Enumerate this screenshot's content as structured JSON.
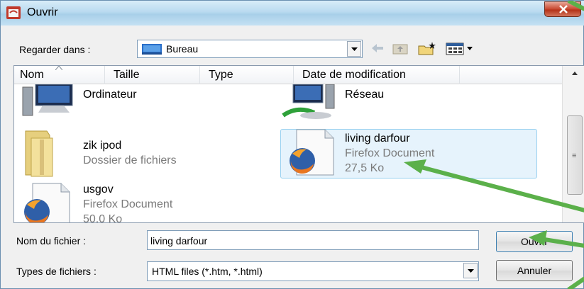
{
  "window": {
    "title": "Ouvrir",
    "close_label": "x"
  },
  "lookin": {
    "label": "Regarder dans :",
    "value": "Bureau",
    "icon": "desktop-icon"
  },
  "toolbar": {
    "icons": [
      "back-arrow-icon",
      "up-folder-icon",
      "new-folder-icon",
      "view-menu-icon"
    ]
  },
  "columns": {
    "name": "Nom",
    "size": "Taille",
    "type": "Type",
    "date": "Date de modification"
  },
  "items": {
    "computer": {
      "name": "Ordinateur",
      "icon": "computer-icon"
    },
    "network": {
      "name": "Réseau",
      "icon": "network-icon"
    },
    "folder": {
      "name": "zik ipod",
      "kind": "Dossier de fichiers",
      "icon": "folder-icon"
    },
    "selected": {
      "name": "living darfour",
      "kind": "Firefox Document",
      "size": "27,5 Ko",
      "icon": "firefox-document-icon"
    },
    "usgov": {
      "name": "usgov",
      "kind": "Firefox Document",
      "size": "50,0 Ko",
      "icon": "firefox-document-icon"
    }
  },
  "filename": {
    "label": "Nom du fichier :",
    "value": "living darfour"
  },
  "filetype": {
    "label": "Types de fichiers :",
    "value": "HTML files (*.htm, *.html)"
  },
  "buttons": {
    "open": "Ouvrir",
    "cancel": "Annuler"
  },
  "colors": {
    "selection_bg": "#e6f3fc",
    "selection_border": "#99d1f0",
    "annotation_arrow": "#5bb04a"
  }
}
